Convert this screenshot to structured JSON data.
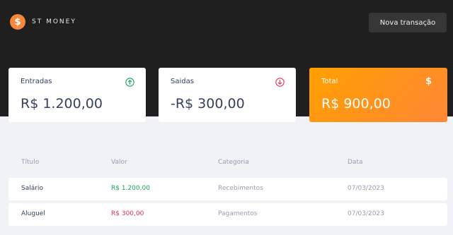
{
  "brand": {
    "symbol": "$",
    "name": "ST MONEY"
  },
  "header": {
    "new_transaction_label": "Nova transação"
  },
  "summary": {
    "income": {
      "label": "Entradas",
      "value": "R$ 1.200,00",
      "icon": "arrow-up-circle-icon",
      "color": "#12a454"
    },
    "outcome": {
      "label": "Saidas",
      "value": "-R$ 300,00",
      "icon": "arrow-down-circle-icon",
      "color": "#e52e4d"
    },
    "total": {
      "label": "Total",
      "value": "R$ 900,00",
      "icon": "dollar-icon",
      "symbol": "$"
    }
  },
  "table": {
    "headers": [
      "Título",
      "Valor",
      "Categoria",
      "Data"
    ],
    "rows": [
      {
        "title": "Salário",
        "value": "R$ 1.200,00",
        "category": "Recebimentos",
        "date": "07/03/2023",
        "type": "income"
      },
      {
        "title": "Aluguel",
        "value": "R$ 300,00",
        "category": "Pagamentos",
        "date": "07/03/2023",
        "type": "outcome"
      }
    ]
  },
  "colors": {
    "header_bg": "#1f1f1f",
    "page_bg": "#f0f2f5",
    "accent": "#ff9a1f",
    "income": "#12a454",
    "outcome": "#e52e4d"
  }
}
